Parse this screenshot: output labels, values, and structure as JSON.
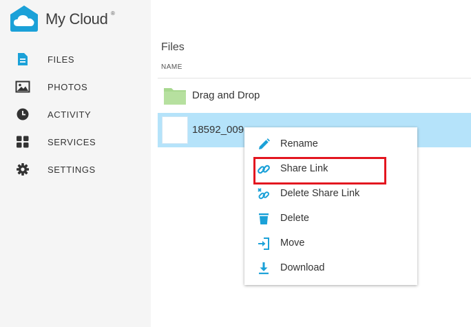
{
  "app": {
    "name": "My Cloud",
    "registered_mark": "®",
    "brand_color": "#1ba1d8"
  },
  "sidebar": {
    "items": [
      {
        "label": "FILES",
        "icon": "file-icon",
        "color": "#1ba1d8"
      },
      {
        "label": "PHOTOS",
        "icon": "photo-icon",
        "color": "#333333"
      },
      {
        "label": "ACTIVITY",
        "icon": "clock-icon",
        "color": "#333333"
      },
      {
        "label": "SERVICES",
        "icon": "grid-icon",
        "color": "#333333"
      },
      {
        "label": "SETTINGS",
        "icon": "gear-icon",
        "color": "#333333"
      }
    ]
  },
  "main": {
    "title": "Files",
    "column_header": "NAME",
    "rows": [
      {
        "name": "Drag and Drop",
        "type": "folder",
        "icon": "folder-icon"
      },
      {
        "name": "18592_009.",
        "type": "file",
        "icon": "image-thumbnail",
        "selected": true
      }
    ]
  },
  "context_menu": {
    "items": [
      {
        "label": "Rename",
        "icon": "pencil-icon"
      },
      {
        "label": "Share Link",
        "icon": "link-icon",
        "highlighted": true
      },
      {
        "label": "Delete Share Link",
        "icon": "unlink-icon"
      },
      {
        "label": "Delete",
        "icon": "trash-icon"
      },
      {
        "label": "Move",
        "icon": "move-icon"
      },
      {
        "label": "Download",
        "icon": "download-icon"
      }
    ],
    "icon_color": "#1ba1d8",
    "highlight_color": "#e3151f"
  },
  "colors": {
    "sidebar_bg": "#f5f5f5",
    "selected_row": "#b5e3fa",
    "folder": "#a8d88f"
  }
}
